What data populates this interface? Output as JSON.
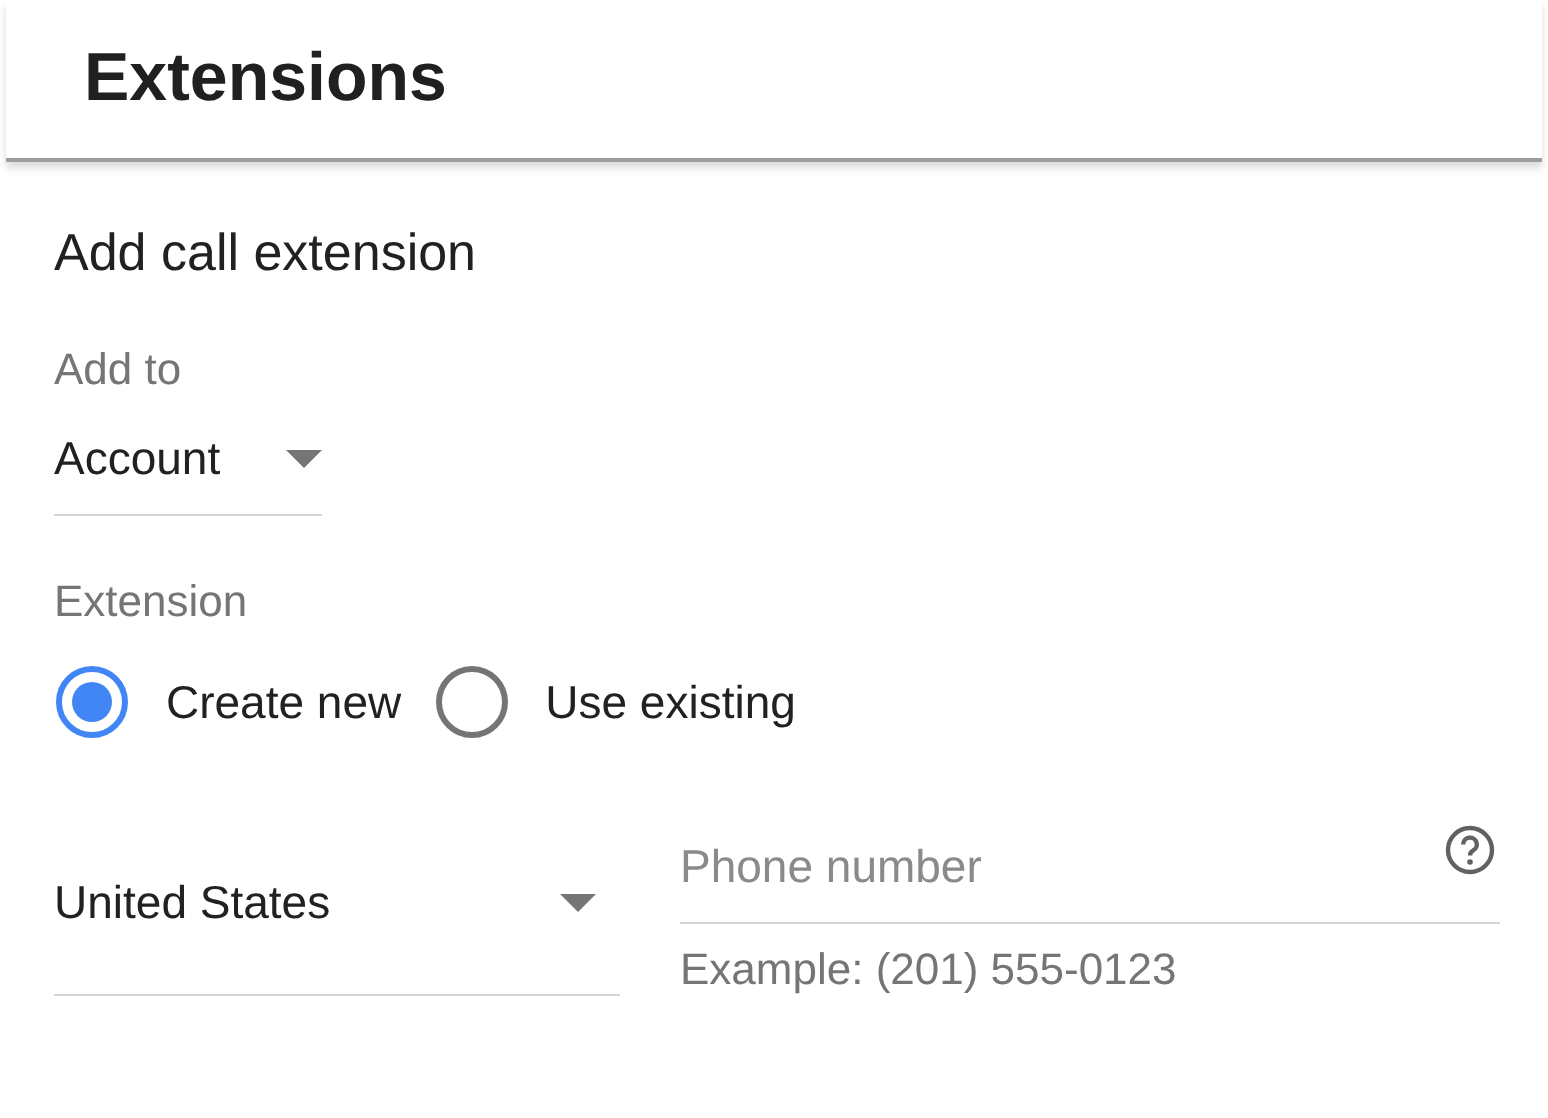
{
  "header": {
    "title": "Extensions"
  },
  "section_title": "Add call extension",
  "add_to": {
    "label": "Add to",
    "value": "Account"
  },
  "extension": {
    "label": "Extension",
    "options": [
      {
        "label": "Create new",
        "selected": true
      },
      {
        "label": "Use existing",
        "selected": false
      }
    ]
  },
  "country": {
    "value": "United States"
  },
  "phone": {
    "placeholder": "Phone number",
    "hint": "Example: (201) 555-0123"
  }
}
